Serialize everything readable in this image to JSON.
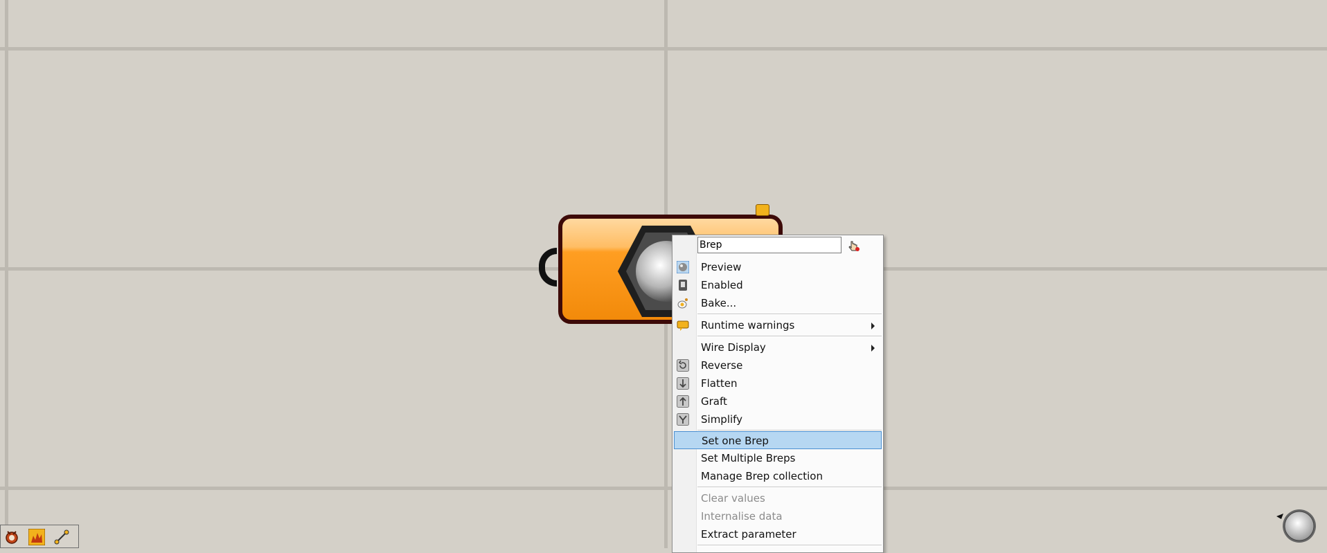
{
  "canvas": {
    "background": "#d4d0c8",
    "grid_color": "#bdb9b1"
  },
  "component": {
    "param_name": "Brep",
    "fill_color": "#ff9e22",
    "border_color": "#3d0a08",
    "icon": "brep-hexagon-icon",
    "warning_icon": "warning-balloon-icon"
  },
  "context_menu": {
    "name_field_value": "Brep",
    "name_tool_icon": "pick-hand-icon",
    "items": [
      {
        "label": "Preview",
        "icon": "preview-sphere-icon",
        "checked": true
      },
      {
        "label": "Enabled",
        "icon": "enabled-switch-icon"
      },
      {
        "label": "Bake...",
        "icon": "bake-egg-icon"
      },
      {
        "label": "Runtime warnings",
        "icon": "warning-balloon-icon",
        "submenu": true
      },
      {
        "label": "Wire Display",
        "submenu": true
      },
      {
        "label": "Reverse",
        "icon": "reverse-icon"
      },
      {
        "label": "Flatten",
        "icon": "flatten-icon"
      },
      {
        "label": "Graft",
        "icon": "graft-icon"
      },
      {
        "label": "Simplify",
        "icon": "simplify-icon"
      },
      {
        "label": "Set one Brep",
        "selected": true
      },
      {
        "label": "Set Multiple Breps"
      },
      {
        "label": "Manage Brep collection"
      },
      {
        "label": "Clear values",
        "disabled": true
      },
      {
        "label": "Internalise data",
        "disabled": true
      },
      {
        "label": "Extract parameter"
      }
    ],
    "highlight_color": "#b6d7f2"
  },
  "toolbar": {
    "buttons": [
      "grasshopper-logo-icon",
      "fire-icon",
      "wire-tool-icon"
    ]
  },
  "navigation": {
    "compass_icon": "navigation-compass-icon"
  }
}
